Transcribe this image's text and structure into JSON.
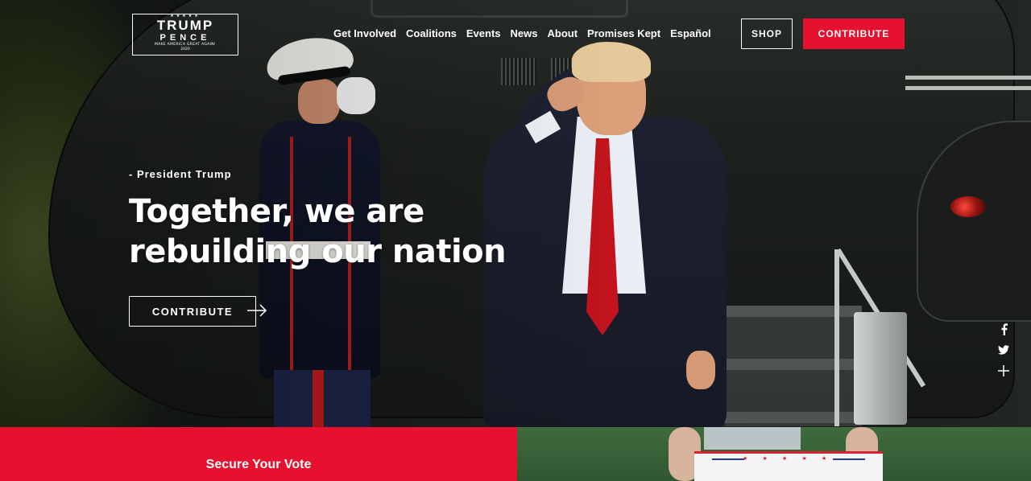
{
  "logo": {
    "stars": "★★★★★",
    "line1": "TRUMP",
    "line2": "PENCE",
    "tagline": "MAKE AMERICA GREAT AGAIN!",
    "year": "2020"
  },
  "nav": {
    "items": [
      {
        "label": "Get Involved"
      },
      {
        "label": "Coalitions"
      },
      {
        "label": "Events"
      },
      {
        "label": "News"
      },
      {
        "label": "About"
      },
      {
        "label": "Promises Kept"
      },
      {
        "label": "Español"
      }
    ],
    "shop_label": "SHOP",
    "contribute_label": "CONTRIBUTE"
  },
  "hero": {
    "attribution": "- President Trump",
    "headline": "Together, we are rebuilding our nation",
    "cta_label": "CONTRIBUTE"
  },
  "social": {
    "icons": [
      "facebook-icon",
      "twitter-icon",
      "plus-icon"
    ]
  },
  "bottom": {
    "left_panel_label": "Secure Your Vote",
    "sign_stars": "★ ★ ★ ★ ★"
  },
  "colors": {
    "accent_red": "#e5112e",
    "white": "#ffffff"
  }
}
